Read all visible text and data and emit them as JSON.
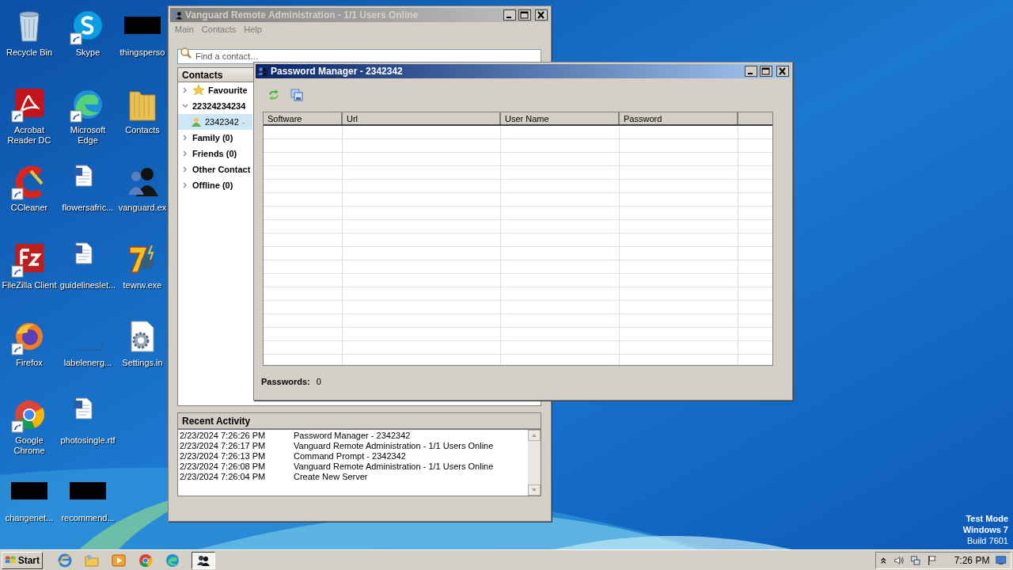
{
  "desktop_icons": [
    {
      "label": "Recycle Bin",
      "shortcut": false
    },
    {
      "label": "Acrobat Reader DC",
      "shortcut": true
    },
    {
      "label": "CCleaner",
      "shortcut": true
    },
    {
      "label": "FileZilla Client",
      "shortcut": true
    },
    {
      "label": "Firefox",
      "shortcut": true
    },
    {
      "label": "Google Chrome",
      "shortcut": true
    },
    {
      "label": "changenet...",
      "shortcut": false
    },
    {
      "label": "Skype",
      "shortcut": true
    },
    {
      "label": "Microsoft Edge",
      "shortcut": true
    },
    {
      "label": "flowersafric...",
      "shortcut": false
    },
    {
      "label": "guidelineslet...",
      "shortcut": false
    },
    {
      "label": "labelenerg...",
      "shortcut": false
    },
    {
      "label": "photosingle.rtf",
      "shortcut": false
    },
    {
      "label": "recommend...",
      "shortcut": false
    },
    {
      "label": "thingsperso",
      "shortcut": false
    },
    {
      "label": "Contacts",
      "shortcut": false
    },
    {
      "label": "vanguard.ex",
      "shortcut": false
    },
    {
      "label": "tewrw.exe",
      "shortcut": false
    },
    {
      "label": "Settings.in",
      "shortcut": false
    }
  ],
  "vanguard_window": {
    "title": "Vanguard Remote Administration - 1/1 Users Online",
    "active": false,
    "menu": [
      "Main",
      "Contacts",
      "Help"
    ],
    "search": {
      "placeholder": "Find a contact…"
    },
    "contacts": {
      "header": "Contacts",
      "groups": [
        {
          "label": "Favourite",
          "expanded": false
        },
        {
          "label": "22324234234",
          "expanded": true,
          "children": [
            {
              "label": "2342342",
              "suffix": "-",
              "selected": true
            }
          ]
        },
        {
          "label": "Family (0)",
          "expanded": false
        },
        {
          "label": "Friends (0)",
          "expanded": false
        },
        {
          "label": "Other Contact",
          "expanded": false
        },
        {
          "label": "Offline (0)",
          "expanded": false
        }
      ]
    },
    "recent_activity": {
      "header": "Recent Activity",
      "entries": [
        {
          "time": "2/23/2024 7:26:26 PM",
          "event": "Password Manager - 2342342"
        },
        {
          "time": "2/23/2024 7:26:17 PM",
          "event": "Vanguard Remote Administration - 1/1 Users Online"
        },
        {
          "time": "2/23/2024 7:26:13 PM",
          "event": "Command Prompt - 2342342"
        },
        {
          "time": "2/23/2024 7:26:08 PM",
          "event": "Vanguard Remote Administration - 1/1 Users Online"
        },
        {
          "time": "2/23/2024 7:26:04 PM",
          "event": "Create New Server"
        }
      ]
    }
  },
  "password_manager": {
    "title": "Password Manager - 2342342",
    "active": true,
    "columns": [
      "Software",
      "Url",
      "User Name",
      "Password"
    ],
    "count_label": "Passwords:",
    "count": "0"
  },
  "os_notice": [
    "Test Mode",
    "Windows 7",
    "Build 7601"
  ],
  "taskbar": {
    "start": "Start",
    "clock": "7:26 PM"
  }
}
